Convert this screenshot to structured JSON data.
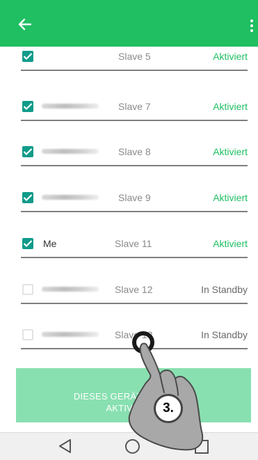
{
  "colors": {
    "accent": "#1fbf62",
    "checkbox": "#109b8a",
    "button": "#88e0b0"
  },
  "appbar": {
    "back_icon": "arrow-left-icon",
    "menu_icon": "more-vert-icon"
  },
  "devices": [
    {
      "name": "",
      "slave": "Slave 5",
      "status": "Aktiviert",
      "checked": true
    },
    {
      "name": "",
      "slave": "Slave 7",
      "status": "Aktiviert",
      "checked": true
    },
    {
      "name": "",
      "slave": "Slave 8",
      "status": "Aktiviert",
      "checked": true
    },
    {
      "name": "",
      "slave": "Slave 9",
      "status": "Aktiviert",
      "checked": true
    },
    {
      "name": "Me",
      "slave": "Slave 11",
      "status": "Aktiviert",
      "checked": true
    },
    {
      "name": "",
      "slave": "Slave 12",
      "status": "In Standby",
      "checked": false
    },
    {
      "name": "",
      "slave": "Slave 13",
      "status": "In Standby",
      "checked": false
    }
  ],
  "button": {
    "label": "Dieses Gerät als Slave Aktivieren"
  },
  "overlay": {
    "step_label": "3."
  }
}
